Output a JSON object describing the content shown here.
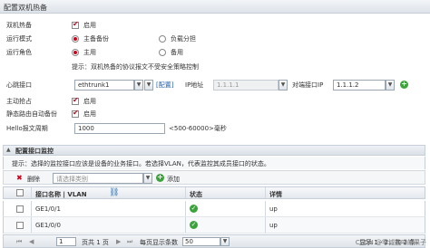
{
  "title": "配置双机热备",
  "form": {
    "hot_standby": {
      "label": "双机热备",
      "check_label": "启用",
      "checked": true
    },
    "run_mode": {
      "label": "运行模式",
      "options": [
        "主备备份",
        "负载分担"
      ],
      "selected": 0
    },
    "run_role": {
      "label": "运行角色",
      "options": [
        "主用",
        "备用"
      ],
      "selected": 0
    },
    "hint": "提示：双机热备的协议报文不受安全策略控制",
    "heartbeat": {
      "label": "心跳接口",
      "value": "ethtrunk1",
      "config_link": "[配置]",
      "ip_label": "IP地址",
      "ip_value": "1.1.1.1",
      "peer_ip_label": "对端接口IP",
      "peer_ip_value": "1.1.1.2"
    },
    "preempt": {
      "label": "主动抢占",
      "check_label": "启用",
      "checked": true
    },
    "static_route_backup": {
      "label": "静态路由自动备份",
      "check_label": "启用",
      "checked": true
    },
    "hello_period": {
      "label": "Hello报文周期",
      "value": "1000",
      "range": "<500-60000>毫秒"
    }
  },
  "monitor": {
    "panel_title": "配置接口监控",
    "hint": "提示：选择的监控接口应该是设备的业务接口。若选择VLAN，代表监控其成员接口的状态。",
    "toolbar": {
      "delete_label": "删除",
      "select_placeholder": "请选择类别",
      "add_label": "添加"
    },
    "columns": [
      "接口名称 | VLAN",
      "状态",
      "详情"
    ],
    "rows": [
      {
        "name": "GE1/0/1",
        "detail": "up"
      },
      {
        "name": "GE1/0/0",
        "detail": "up"
      }
    ]
  },
  "pager": {
    "page": "1",
    "page_total": "页共 1 页",
    "per_page_label": "每页显示条数",
    "per_page": "50",
    "summary": "显示 1 - 2，共 2 条"
  },
  "watermark": "CSDN @零域咖啡的果子",
  "colors": {
    "check": "#d0021b",
    "ok": "#3aa43a",
    "link": "#1a5fb4"
  }
}
